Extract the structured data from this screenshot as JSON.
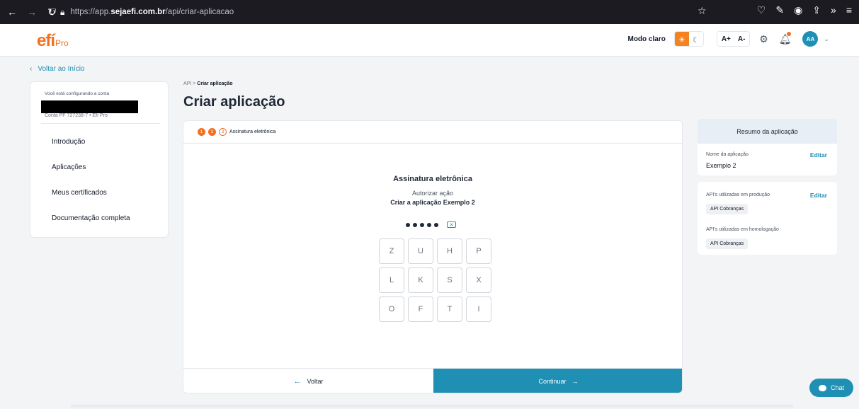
{
  "browser": {
    "url_prefix": "https://app.",
    "url_domain": "sejaefi.com.br",
    "url_path": "/api/criar-aplicacao"
  },
  "header": {
    "logo_main": "efí",
    "logo_sub": "Pro",
    "theme_label": "Modo claro",
    "font_increase": "A+",
    "font_decrease": "A-",
    "avatar_initials": "AA"
  },
  "back_link": "Voltar ao Início",
  "sidebar": {
    "account_label": "Você está configurando a conta",
    "account_sub": "Conta PF 727238-7 • Efí Pro",
    "items": [
      {
        "label": "Introdução"
      },
      {
        "label": "Aplicações"
      },
      {
        "label": "Meus certificados"
      },
      {
        "label": "Documentação completa"
      }
    ]
  },
  "breadcrumb": {
    "parent": "API",
    "separator": ">",
    "current": "Criar aplicação"
  },
  "page_title": "Criar aplicação",
  "stepper": {
    "steps": [
      "1",
      "2",
      "3"
    ],
    "current_label": "Assinatura eletrônica"
  },
  "signature": {
    "title": "Assinatura eletrônica",
    "subtitle": "Autorizar ação",
    "action": "Criar a aplicação Exemplo 2",
    "password_length": 5,
    "keys": [
      "Z",
      "U",
      "H",
      "P",
      "L",
      "K",
      "S",
      "X",
      "O",
      "F",
      "T",
      "I"
    ]
  },
  "footer": {
    "back_label": "Voltar",
    "continue_label": "Continuar"
  },
  "summary": {
    "title": "Resumo da aplicação",
    "name_label": "Nome da aplicação",
    "name_value": "Exemplo 2",
    "edit_label": "Editar",
    "prod_label": "API's utilizadas em produção",
    "prod_chip": "API Cobranças",
    "homolog_label": "API's utilizadas em homologação",
    "homolog_chip": "API Cobranças"
  },
  "chat_label": "Chat",
  "colors": {
    "brand_orange": "#f37021",
    "primary_blue": "#1f8fb3"
  }
}
